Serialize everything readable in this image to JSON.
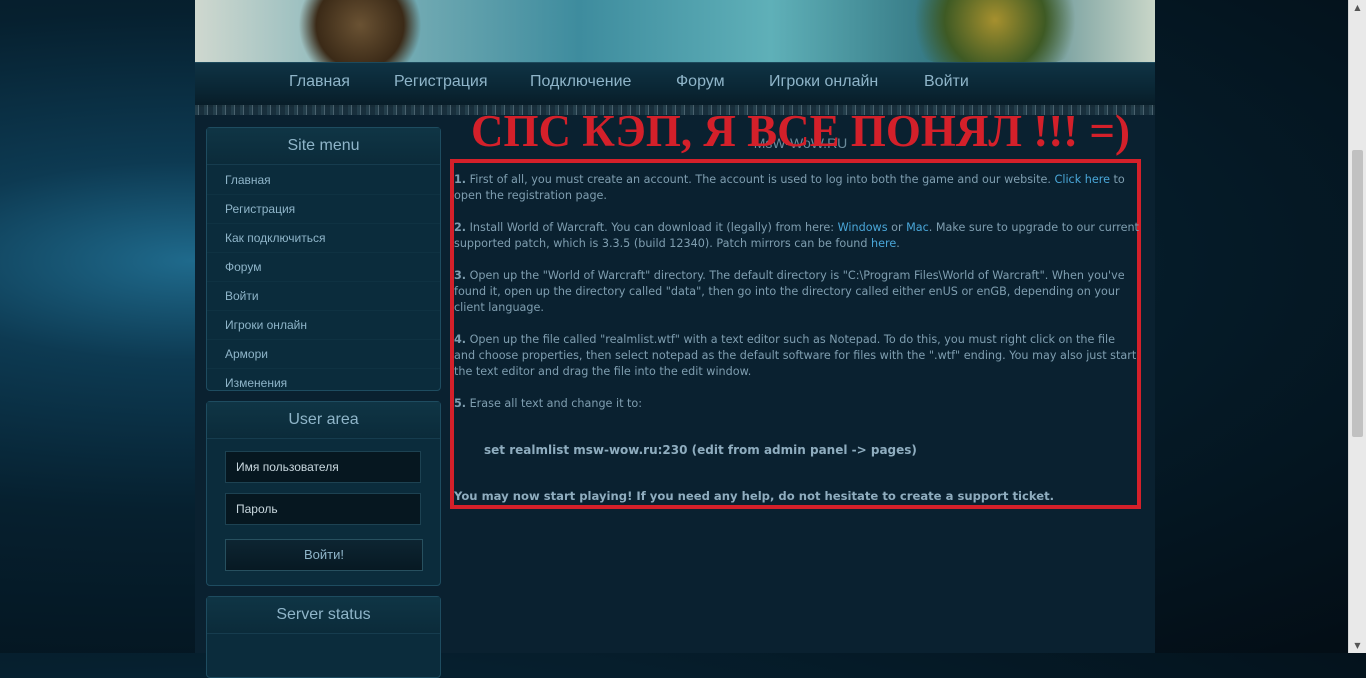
{
  "nav": [
    "Главная",
    "Регистрация",
    "Подключение",
    "Форум",
    "Игроки онлайн",
    "Войти"
  ],
  "site_menu": {
    "title": "Site menu",
    "items": [
      "Главная",
      "Регистрация",
      "Как подключиться",
      "Форум",
      "Войти",
      "Игроки онлайн",
      "Армори",
      "Изменения"
    ]
  },
  "user_area": {
    "title": "User area",
    "username_placeholder": "Имя пользователя",
    "password_placeholder": "Пароль",
    "login_button": "Войти!"
  },
  "server_status": {
    "title": "Server status"
  },
  "content": {
    "headline": "СПС КЭП, Я ВСЕ ПОНЯЛ !!! =)",
    "subtitle": "MsW-WoW.RU",
    "steps": [
      {
        "num": "1.",
        "text": "First of all, you must create an account. The account is used to log into both the game and our website. ",
        "link": "Click here",
        "after": " to open the registration page."
      },
      {
        "num": "2.",
        "text_a": "Install World of Warcraft. You can download it (legally) from here: ",
        "link_a": "Windows",
        "text_b": " or ",
        "link_b": "Mac",
        "text_c": ". Make sure to upgrade to our current supported patch, which is 3.3.5 (build 12340). Patch mirrors can be found ",
        "link_c": "here",
        "text_d": "."
      },
      {
        "num": "3.",
        "text": "Open up the \"World of Warcraft\" directory. The default directory is \"C:\\Program Files\\World of Warcraft\". When you've found it, open up the directory called \"data\", then go into the directory called either enUS or enGB, depending on your client language."
      },
      {
        "num": "4.",
        "text": "Open up the file called \"realmlist.wtf\" with a text editor such as Notepad. To do this, you must right click on the file and choose properties, then select notepad as the default software for files with the \".wtf\" ending. You may also just start the text editor and drag the file into the edit window."
      },
      {
        "num": "5.",
        "text": "Erase all text and change it to:"
      }
    ],
    "code": "set realmlist msw-wow.ru:230 (edit from admin panel -> pages)",
    "final": "You may now start playing! If you need any help, do not hesitate to create a support ticket."
  }
}
